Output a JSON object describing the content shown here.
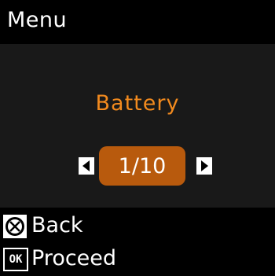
{
  "header": {
    "title": "Menu"
  },
  "main": {
    "item_label": "Battery",
    "counter": "1/10",
    "accent_color": "#f28a1e",
    "counter_bg": "#b85a0d"
  },
  "footer": {
    "back": {
      "icon": "stop-icon",
      "label": "Back"
    },
    "proceed": {
      "icon_text": "OK",
      "label": "Proceed"
    }
  }
}
